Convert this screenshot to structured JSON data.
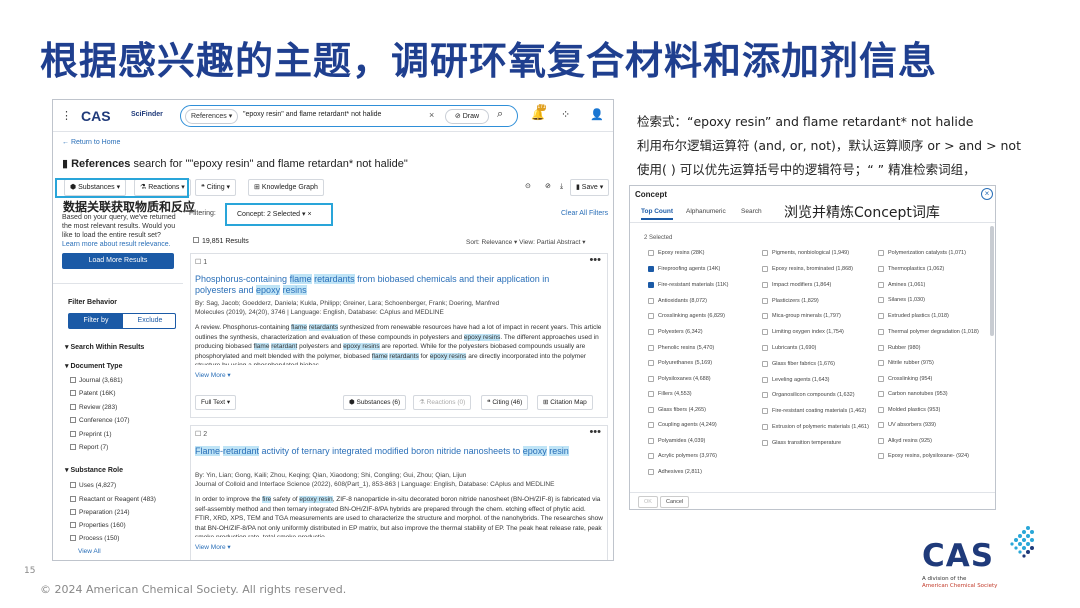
{
  "slide": {
    "title": "根据感兴趣的主题，调研环氧复合材料和添加剂信息",
    "page_number": "15",
    "copyright": "© 2024 American Chemical Society. All rights reserved.",
    "logo_text": "CAS",
    "logo_sub_1": "A division of the",
    "logo_sub_2": "American Chemical Society"
  },
  "notes": {
    "line1": "检索式：“epoxy resin” and flame retardant* not halide",
    "line2": "利用布尔逻辑运算符 (and, or, not)，默认运算顺序 or > and > not",
    "line3": "使用( ) 可以优先运算括号中的逻辑符号；“ ” 精准检索词组，",
    "left_annotation": "数据关联获取物质和反应",
    "concept_annotation": "浏览并精炼Concept词库"
  },
  "scifinder": {
    "menu_icon": "⋮",
    "logo": "CAS",
    "product": "SciFinder",
    "search_type": "References ▾",
    "query": "\"epoxy resin\" and flame retardant* not halide",
    "clear": "×",
    "draw_label": "Draw",
    "search_icon": "⌕",
    "bell_badge": "171",
    "return_home": "← Return to Home",
    "ref_header_bold": "References",
    "ref_header_rest": " search for \"\"epoxy resin\" and flame retardan* not halide\"",
    "toolbar": {
      "substances": "Substances ▾",
      "reactions": "Reactions ▾",
      "citing": "Citing ▾",
      "knowledge_graph": "Knowledge Graph",
      "save": "Save ▾"
    },
    "left_panel": {
      "info": "Based on your query, we've returned the most relevant results. Would you like to load the entire result set?",
      "learn_more": "Learn more about result relevance.",
      "load_more": "Load More Results",
      "filter_behavior": "Filter Behavior",
      "filter_by": "Filter by",
      "exclude": "Exclude",
      "search_within": "Search Within Results",
      "document_type": "Document Type",
      "doc_types": [
        "Journal (3,681)",
        "Patent (16K)",
        "Review (283)",
        "Conference (107)",
        "Preprint (1)",
        "Report (7)"
      ],
      "substance_role": "Substance Role",
      "roles": [
        "Uses (4,827)",
        "Reactant or Reagent (483)",
        "Preparation (214)",
        "Properties (160)",
        "Process (150)"
      ],
      "view_all": "View All"
    },
    "filtering_label": "Filtering:",
    "concept_chip": "Concept: 2 Selected ▾  ×",
    "clear_all": "Clear All Filters",
    "result_count": "19,851 Results",
    "sort_text": "Sort: Relevance ▾    View: Partial Abstract ▾",
    "result1": {
      "num": "1",
      "title": "Phosphorus-containing flame retardants from biobased chemicals and their application in polyesters and epoxy resins",
      "authors": "By: Sag, Jacob; Goedderz, Daniela; Kukla, Philipp; Greiner, Lara; Schoenberger, Frank; Doering, Manfred",
      "source": "Molecules (2019), 24(20), 3746 | Language: English, Database: CAplus and MEDLINE",
      "abstract": "A review. Phosphorus-containing flame retardants synthesized from renewable resources have had a lot of impact in recent years. This article outlines the synthesis, characterization and evaluation of these compounds in polyesters and epoxy resins. The different approaches used in producing biobased flame retardant polyesters and epoxy resins are reported. While for the polyesters biobased compounds usually are phosphorylated and melt blended with the polymer, biobased flame retardants for epoxy resins are directly incorporated into the polymer structure by using a phosphorylated biobas",
      "view_more": "View More ▾",
      "full_text": "Full Text ▾",
      "substances": "Substances (6)",
      "reactions": "Reactions (0)",
      "citing": "Citing (46)",
      "citation_map": "Citation Map"
    },
    "result2": {
      "num": "2",
      "title": "Flame-retardant activity of ternary integrated modified boron nitride nanosheets to epoxy resin",
      "authors": "By: Yin, Lian; Gong, Kaili; Zhou, Keqing; Qian, Xiaodong; Shi, Congling; Gui, Zhou; Qian, Lijun",
      "source": "Journal of Colloid and Interface Science (2022), 608(Part_1), 853-863 | Language: English, Database: CAplus and MEDLINE",
      "abstract": "In order to improve the fire safety of epoxy resin, ZIF-8 nanoparticle in-situ decorated boron nitride nanosheet (BN-OH/ZIF-8) is fabricated via self-assembly method and then ternary integrated BN-OH/ZIF-8/PA hybrids are prepared through the chem. etching effect of phytic acid. FTIR, XRD, XPS, TEM and TGA measurements are used to characterize the structure and morphol. of the nanohybrids. The researches show that BN-OH/ZIF-8/PA not only uniformly distributed in EP matrix, but also improve the thermal stability of EP. The peak heat release rate, peak smoke production rate, total smoke productio",
      "view_more": "View More ▾"
    }
  },
  "concept_dialog": {
    "title": "Concept",
    "close": "×",
    "tabs": [
      "Top Count",
      "Alphanumeric",
      "Search"
    ],
    "selected": "2 Selected",
    "col1": [
      "Epoxy resins (28K)",
      "Fireproofing agents (14K)",
      "Fire-resistant materials (11K)",
      "Antioxidants (8,072)",
      "Crosslinking agents (6,829)",
      "Polyesters (6,342)",
      "Phenolic resins (5,470)",
      "Polyurethanes (5,169)",
      "Polysiloxanes (4,688)",
      "Fillers (4,553)",
      "Glass fibers (4,265)",
      "Coupling agents (4,249)",
      "Polyamides (4,039)",
      "Acrylic polymers (3,976)",
      "Adhesives (2,811)"
    ],
    "col2": [
      "Pigments, nonbiological (1,949)",
      "Epoxy resins, brominated (1,868)",
      "Impact modifiers (1,864)",
      "Plasticizers (1,829)",
      "Mica-group minerals (1,797)",
      "Limiting oxygen index (1,754)",
      "Lubricants (1,690)",
      "Glass fiber fabrics (1,676)",
      "Leveling agents (1,643)",
      "Organosilicon compounds (1,632)",
      "Fire-resistant coating materials (1,462)",
      "Extrusion of polymeric materials (1,461)",
      "Glass transition temperature"
    ],
    "col3": [
      "Polymerization catalysts (1,071)",
      "Thermoplastics (1,062)",
      "Amines (1,061)",
      "Silanes (1,030)",
      "Extruded plastics (1,018)",
      "Thermal polymer degradation (1,018)",
      "Rubber (980)",
      "Nitrile rubber (975)",
      "Crosslinking (954)",
      "Carbon nanotubes (953)",
      "Molded plastics (953)",
      "UV absorbers (939)",
      "Alkyd resins (925)",
      "Epoxy resins, polysiloxane- (924)"
    ],
    "ok": "OK",
    "cancel": "Cancel"
  },
  "colors": {
    "title_blue": "#1f3f8f",
    "highlight_box": "#29a5d9",
    "link_blue": "#2a6fb8",
    "button_blue": "#1b5aa6",
    "term_highlight": "#bfe4f6"
  }
}
